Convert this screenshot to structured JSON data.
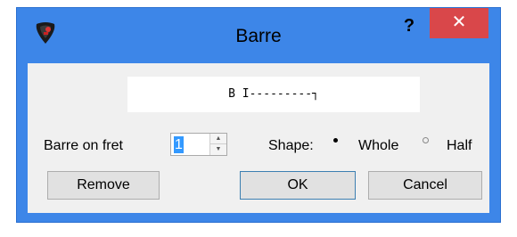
{
  "window": {
    "title": "Barre",
    "help_label": "?",
    "close_label": "✕",
    "icon": "guitar-pick-icon"
  },
  "preview": {
    "text": "B I---------┐"
  },
  "fret": {
    "label": "Barre on fret",
    "value": "1"
  },
  "shape": {
    "label": "Shape:",
    "options": [
      {
        "label": "Whole",
        "selected": true
      },
      {
        "label": "Half",
        "selected": false
      }
    ]
  },
  "buttons": {
    "remove": "Remove",
    "ok": "OK",
    "cancel": "Cancel"
  },
  "colors": {
    "titlebar": "#3d86e8",
    "close": "#d9474a",
    "client": "#f0f0f0",
    "selection": "#3399ff"
  }
}
